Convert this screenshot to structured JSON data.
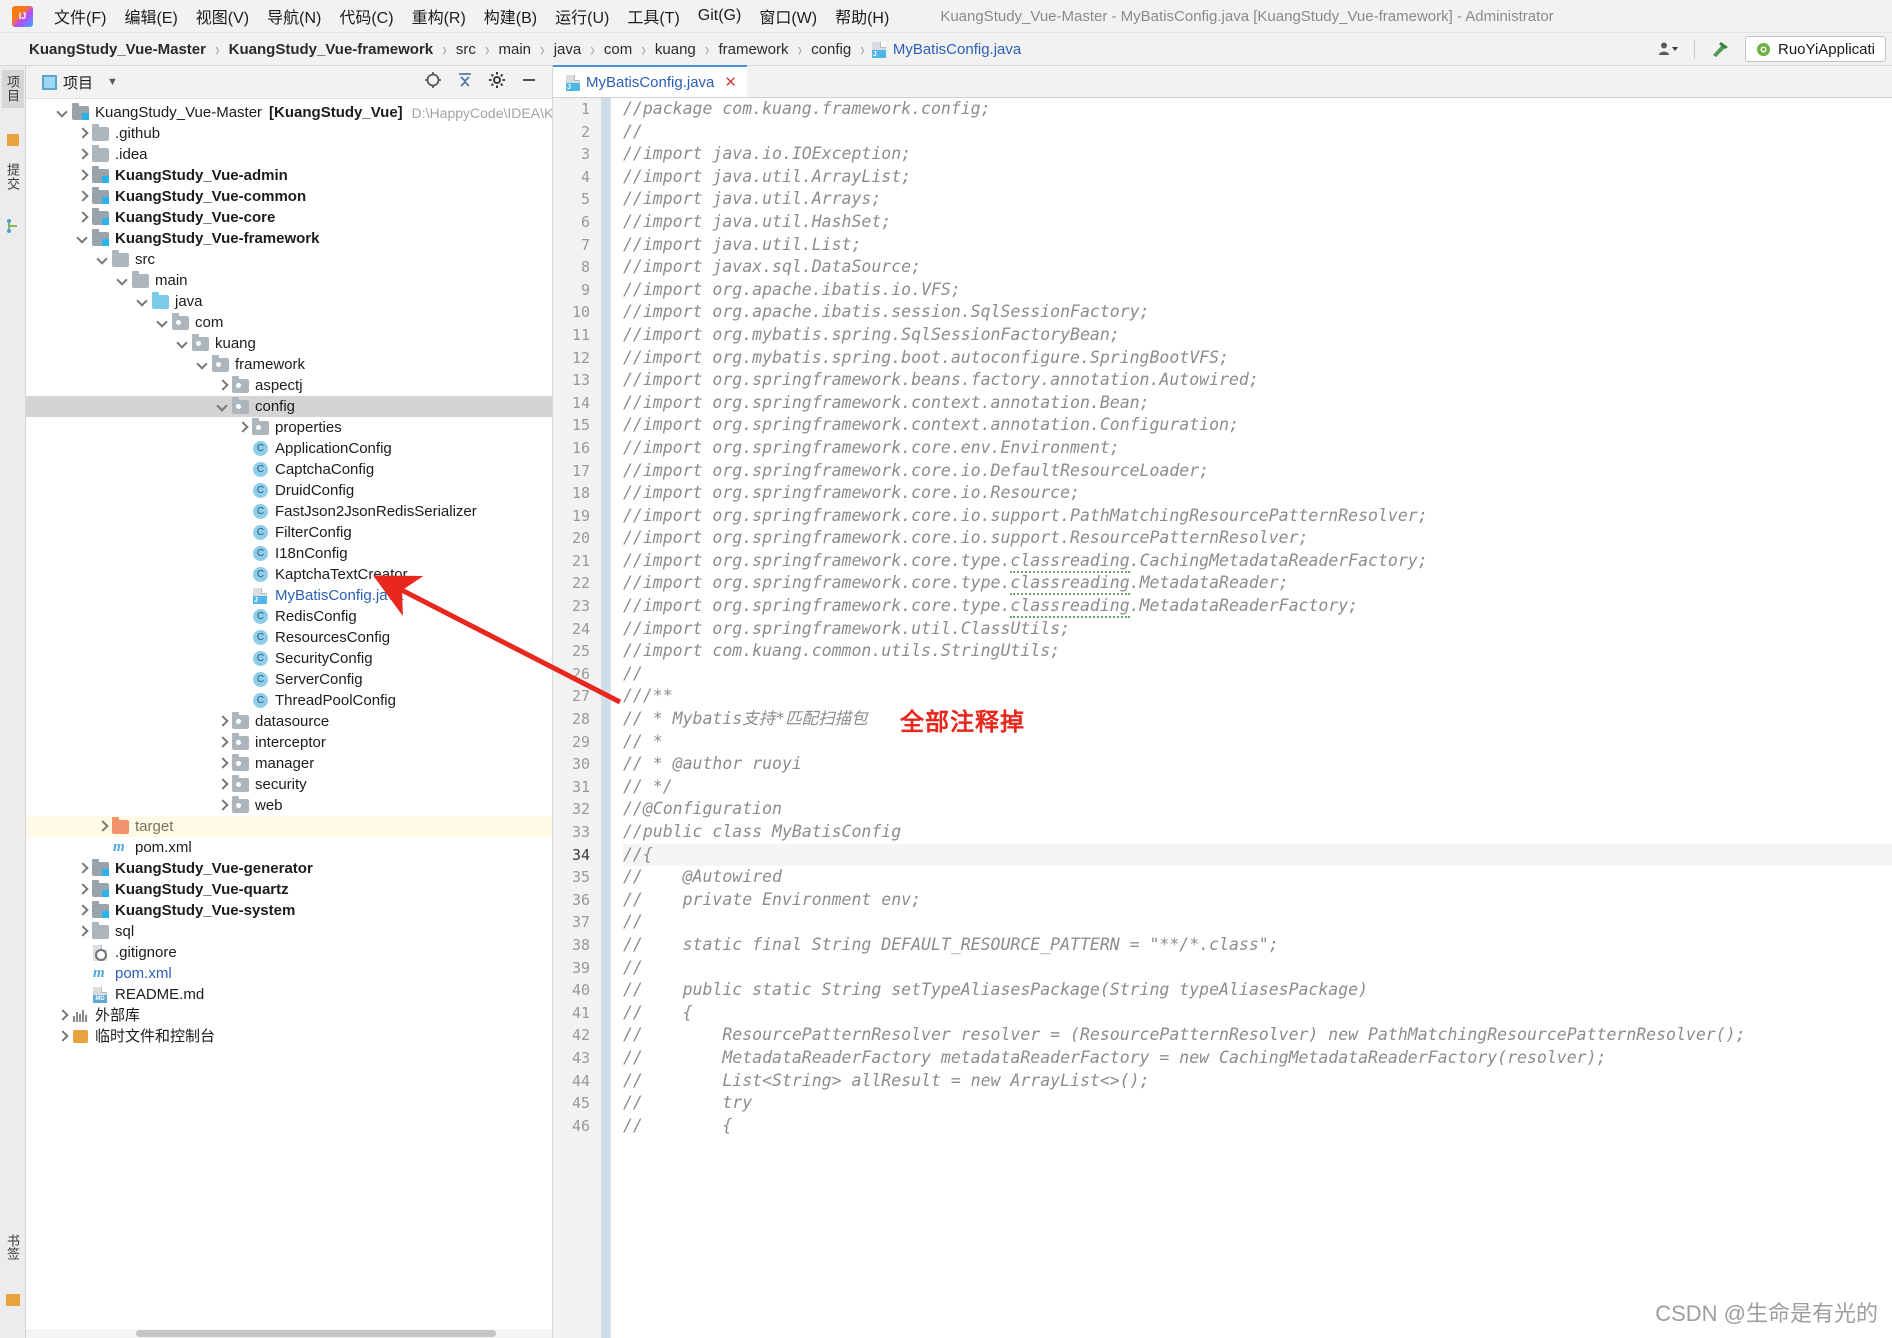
{
  "window": {
    "title": "KuangStudy_Vue-Master - MyBatisConfig.java [KuangStudy_Vue-framework] - Administrator",
    "logo_icon": "intellij-idea-logo-icon"
  },
  "menu": {
    "items": [
      {
        "label": "文件(F)",
        "name": "menu-file"
      },
      {
        "label": "编辑(E)",
        "name": "menu-edit"
      },
      {
        "label": "视图(V)",
        "name": "menu-view"
      },
      {
        "label": "导航(N)",
        "name": "menu-navigate"
      },
      {
        "label": "代码(C)",
        "name": "menu-code"
      },
      {
        "label": "重构(R)",
        "name": "menu-refactor"
      },
      {
        "label": "构建(B)",
        "name": "menu-build"
      },
      {
        "label": "运行(U)",
        "name": "menu-run"
      },
      {
        "label": "工具(T)",
        "name": "menu-tools"
      },
      {
        "label": "Git(G)",
        "name": "menu-git"
      },
      {
        "label": "窗口(W)",
        "name": "menu-window"
      },
      {
        "label": "帮助(H)",
        "name": "menu-help"
      }
    ]
  },
  "breadcrumb": {
    "items": [
      {
        "label": "KuangStudy_Vue-Master",
        "style": "bold"
      },
      {
        "label": "KuangStudy_Vue-framework",
        "style": "bold"
      },
      {
        "label": "src",
        "style": "plain"
      },
      {
        "label": "main",
        "style": "plain"
      },
      {
        "label": "java",
        "style": "plain"
      },
      {
        "label": "com",
        "style": "plain"
      },
      {
        "label": "kuang",
        "style": "plain"
      },
      {
        "label": "framework",
        "style": "plain"
      },
      {
        "label": "config",
        "style": "plain"
      },
      {
        "label": "MyBatisConfig.java",
        "style": "link",
        "icon": "java-file-icon"
      }
    ],
    "separator": "›"
  },
  "toolbar_right": {
    "user_icon": "user-dropdown-icon",
    "hammer_icon": "build-hammer-icon",
    "run_config": "RuoYiApplicati",
    "run_config_icon": "spring-boot-icon"
  },
  "tool_strip": {
    "left_tabs": [
      {
        "label": "项目",
        "name": "tool-tab-project",
        "selected": true
      },
      {
        "label": "提交",
        "name": "tool-tab-commit",
        "selected": false
      }
    ],
    "bottom_tabs": [
      {
        "label": "书签",
        "name": "tool-tab-bookmarks"
      }
    ],
    "bookmark_icon": "bookmark-icon",
    "structure_icon": "structure-icon"
  },
  "project_panel": {
    "title": "项目",
    "title_icon": "project-view-icon",
    "dropdown_icon": "chevron-down-icon",
    "header_buttons": [
      {
        "name": "locate-file-icon",
        "label": "⊕"
      },
      {
        "name": "collapse-all-icon",
        "label": "⇱"
      },
      {
        "name": "settings-gear-icon",
        "label": "⚙"
      },
      {
        "name": "hide-panel-icon",
        "label": "—"
      }
    ],
    "tree": [
      {
        "depth": 0,
        "label": "KuangStudy_Vue-Master",
        "extra": "[KuangStudy_Vue]",
        "path": "D:\\HappyCode\\IDEA\\KuangStu",
        "icon": "module-icon",
        "arrow": "open",
        "style": "plain"
      },
      {
        "depth": 1,
        "label": ".github",
        "icon": "folder-icon",
        "arrow": "closed",
        "style": "plain"
      },
      {
        "depth": 1,
        "label": ".idea",
        "icon": "folder-icon",
        "arrow": "closed",
        "style": "plain"
      },
      {
        "depth": 1,
        "label": "KuangStudy_Vue-admin",
        "icon": "module-icon",
        "arrow": "closed",
        "style": "bold"
      },
      {
        "depth": 1,
        "label": "KuangStudy_Vue-common",
        "icon": "module-icon",
        "arrow": "closed",
        "style": "bold"
      },
      {
        "depth": 1,
        "label": "KuangStudy_Vue-core",
        "icon": "module-icon",
        "arrow": "closed",
        "style": "bold"
      },
      {
        "depth": 1,
        "label": "KuangStudy_Vue-framework",
        "icon": "module-icon",
        "arrow": "open",
        "style": "bold"
      },
      {
        "depth": 2,
        "label": "src",
        "icon": "folder-icon",
        "arrow": "open",
        "style": "plain"
      },
      {
        "depth": 3,
        "label": "main",
        "icon": "folder-icon",
        "arrow": "open",
        "style": "plain"
      },
      {
        "depth": 4,
        "label": "java",
        "icon": "source-folder-icon",
        "arrow": "open",
        "style": "plain"
      },
      {
        "depth": 5,
        "label": "com",
        "icon": "package-icon",
        "arrow": "open",
        "style": "plain"
      },
      {
        "depth": 6,
        "label": "kuang",
        "icon": "package-icon",
        "arrow": "open",
        "style": "plain"
      },
      {
        "depth": 7,
        "label": "framework",
        "icon": "package-icon",
        "arrow": "open",
        "style": "plain"
      },
      {
        "depth": 8,
        "label": "aspectj",
        "icon": "package-icon",
        "arrow": "closed",
        "style": "plain"
      },
      {
        "depth": 8,
        "label": "config",
        "icon": "package-icon",
        "arrow": "open",
        "style": "plain",
        "selected": true
      },
      {
        "depth": 9,
        "label": "properties",
        "icon": "package-icon",
        "arrow": "closed",
        "style": "plain"
      },
      {
        "depth": 9,
        "label": "ApplicationConfig",
        "icon": "java-class-icon",
        "arrow": "none",
        "style": "plain"
      },
      {
        "depth": 9,
        "label": "CaptchaConfig",
        "icon": "java-class-icon",
        "arrow": "none",
        "style": "plain"
      },
      {
        "depth": 9,
        "label": "DruidConfig",
        "icon": "java-class-icon",
        "arrow": "none",
        "style": "plain"
      },
      {
        "depth": 9,
        "label": "FastJson2JsonRedisSerializer",
        "icon": "java-class-icon",
        "arrow": "none",
        "style": "plain"
      },
      {
        "depth": 9,
        "label": "FilterConfig",
        "icon": "java-class-icon",
        "arrow": "none",
        "style": "plain"
      },
      {
        "depth": 9,
        "label": "I18nConfig",
        "icon": "java-class-icon",
        "arrow": "none",
        "style": "plain"
      },
      {
        "depth": 9,
        "label": "KaptchaTextCreator",
        "icon": "java-class-icon",
        "arrow": "none",
        "style": "plain"
      },
      {
        "depth": 9,
        "label": "MyBatisConfig.java",
        "icon": "java-file-icon",
        "arrow": "none",
        "style": "link"
      },
      {
        "depth": 9,
        "label": "RedisConfig",
        "icon": "java-class-icon",
        "arrow": "none",
        "style": "plain"
      },
      {
        "depth": 9,
        "label": "ResourcesConfig",
        "icon": "java-class-icon",
        "arrow": "none",
        "style": "plain"
      },
      {
        "depth": 9,
        "label": "SecurityConfig",
        "icon": "java-class-icon",
        "arrow": "none",
        "style": "plain"
      },
      {
        "depth": 9,
        "label": "ServerConfig",
        "icon": "java-class-icon",
        "arrow": "none",
        "style": "plain"
      },
      {
        "depth": 9,
        "label": "ThreadPoolConfig",
        "icon": "java-class-icon",
        "arrow": "none",
        "style": "plain"
      },
      {
        "depth": 8,
        "label": "datasource",
        "icon": "package-icon",
        "arrow": "closed",
        "style": "plain"
      },
      {
        "depth": 8,
        "label": "interceptor",
        "icon": "package-icon",
        "arrow": "closed",
        "style": "plain"
      },
      {
        "depth": 8,
        "label": "manager",
        "icon": "package-icon",
        "arrow": "closed",
        "style": "plain"
      },
      {
        "depth": 8,
        "label": "security",
        "icon": "package-icon",
        "arrow": "closed",
        "style": "plain"
      },
      {
        "depth": 8,
        "label": "web",
        "icon": "package-icon",
        "arrow": "closed",
        "style": "plain"
      },
      {
        "depth": 2,
        "label": "target",
        "icon": "target-folder-icon",
        "arrow": "closed",
        "style": "excluded",
        "excluded": true
      },
      {
        "depth": 2,
        "label": "pom.xml",
        "icon": "maven-icon",
        "arrow": "none",
        "style": "plain"
      },
      {
        "depth": 1,
        "label": "KuangStudy_Vue-generator",
        "icon": "module-icon",
        "arrow": "closed",
        "style": "bold"
      },
      {
        "depth": 1,
        "label": "KuangStudy_Vue-quartz",
        "icon": "module-icon",
        "arrow": "closed",
        "style": "bold"
      },
      {
        "depth": 1,
        "label": "KuangStudy_Vue-system",
        "icon": "module-icon",
        "arrow": "closed",
        "style": "bold"
      },
      {
        "depth": 1,
        "label": "sql",
        "icon": "folder-icon",
        "arrow": "closed",
        "style": "plain"
      },
      {
        "depth": 1,
        "label": ".gitignore",
        "icon": "gitignore-icon",
        "arrow": "none",
        "style": "plain"
      },
      {
        "depth": 1,
        "label": "pom.xml",
        "icon": "maven-icon",
        "arrow": "none",
        "style": "link"
      },
      {
        "depth": 1,
        "label": "README.md",
        "icon": "markdown-icon",
        "arrow": "none",
        "style": "plain"
      },
      {
        "depth": 0,
        "label": "外部库",
        "icon": "library-icon",
        "arrow": "closed",
        "style": "plain"
      },
      {
        "depth": 0,
        "label": "临时文件和控制台",
        "icon": "scratches-icon",
        "arrow": "closed",
        "style": "plain"
      }
    ]
  },
  "editor": {
    "tab": {
      "label": "MyBatisConfig.java",
      "icon": "java-file-icon",
      "close_icon": "close-icon"
    },
    "current_line": 34,
    "lines": [
      {
        "n": 1,
        "text": "//package com.kuang.framework.config;"
      },
      {
        "n": 2,
        "text": "//"
      },
      {
        "n": 3,
        "text": "//import java.io.IOException;"
      },
      {
        "n": 4,
        "text": "//import java.util.ArrayList;"
      },
      {
        "n": 5,
        "text": "//import java.util.Arrays;"
      },
      {
        "n": 6,
        "text": "//import java.util.HashSet;"
      },
      {
        "n": 7,
        "text": "//import java.util.List;"
      },
      {
        "n": 8,
        "text": "//import javax.sql.DataSource;"
      },
      {
        "n": 9,
        "text": "//import org.apache.ibatis.io.VFS;"
      },
      {
        "n": 10,
        "text": "//import org.apache.ibatis.session.SqlSessionFactory;"
      },
      {
        "n": 11,
        "text": "//import org.mybatis.spring.SqlSessionFactoryBean;"
      },
      {
        "n": 12,
        "text": "//import org.mybatis.spring.boot.autoconfigure.SpringBootVFS;"
      },
      {
        "n": 13,
        "text": "//import org.springframework.beans.factory.annotation.Autowired;"
      },
      {
        "n": 14,
        "text": "//import org.springframework.context.annotation.Bean;"
      },
      {
        "n": 15,
        "text": "//import org.springframework.context.annotation.Configuration;"
      },
      {
        "n": 16,
        "text": "//import org.springframework.core.env.Environment;"
      },
      {
        "n": 17,
        "text": "//import org.springframework.core.io.DefaultResourceLoader;"
      },
      {
        "n": 18,
        "text": "//import org.springframework.core.io.Resource;"
      },
      {
        "n": 19,
        "text": "//import org.springframework.core.io.support.PathMatchingResourcePatternResolver;"
      },
      {
        "n": 20,
        "text": "//import org.springframework.core.io.support.ResourcePatternResolver;"
      },
      {
        "n": 21,
        "text": "//import org.springframework.core.type.classreading.CachingMetadataReaderFactory;",
        "squiggle": "classreading"
      },
      {
        "n": 22,
        "text": "//import org.springframework.core.type.classreading.MetadataReader;",
        "squiggle": "classreading"
      },
      {
        "n": 23,
        "text": "//import org.springframework.core.type.classreading.MetadataReaderFactory;",
        "squiggle": "classreading"
      },
      {
        "n": 24,
        "text": "//import org.springframework.util.ClassUtils;"
      },
      {
        "n": 25,
        "text": "//import com.kuang.common.utils.StringUtils;"
      },
      {
        "n": 26,
        "text": "//"
      },
      {
        "n": 27,
        "text": "///**"
      },
      {
        "n": 28,
        "text": "// * Mybatis支持*匹配扫描包"
      },
      {
        "n": 29,
        "text": "// *"
      },
      {
        "n": 30,
        "text": "// * @author ruoyi"
      },
      {
        "n": 31,
        "text": "// */"
      },
      {
        "n": 32,
        "text": "//@Configuration"
      },
      {
        "n": 33,
        "text": "//public class MyBatisConfig"
      },
      {
        "n": 34,
        "text": "//{",
        "current": true
      },
      {
        "n": 35,
        "text": "//    @Autowired"
      },
      {
        "n": 36,
        "text": "//    private Environment env;"
      },
      {
        "n": 37,
        "text": "//"
      },
      {
        "n": 38,
        "text": "//    static final String DEFAULT_RESOURCE_PATTERN = \"**/*.class\";"
      },
      {
        "n": 39,
        "text": "//"
      },
      {
        "n": 40,
        "text": "//    public static String setTypeAliasesPackage(String typeAliasesPackage)"
      },
      {
        "n": 41,
        "text": "//    {"
      },
      {
        "n": 42,
        "text": "//        ResourcePatternResolver resolver = (ResourcePatternResolver) new PathMatchingResourcePatternResolver();"
      },
      {
        "n": 43,
        "text": "//        MetadataReaderFactory metadataReaderFactory = new CachingMetadataReaderFactory(resolver);"
      },
      {
        "n": 44,
        "text": "//        List<String> allResult = new ArrayList<>();",
        "diamond": true
      },
      {
        "n": 45,
        "text": "//        try"
      },
      {
        "n": 46,
        "text": "//        {"
      }
    ]
  },
  "annotation": {
    "text": "全部注释掉",
    "color": "#e8271d",
    "arrow_name": "red-pointer-arrow"
  },
  "watermark": {
    "text": "CSDN @生命是有光的"
  }
}
